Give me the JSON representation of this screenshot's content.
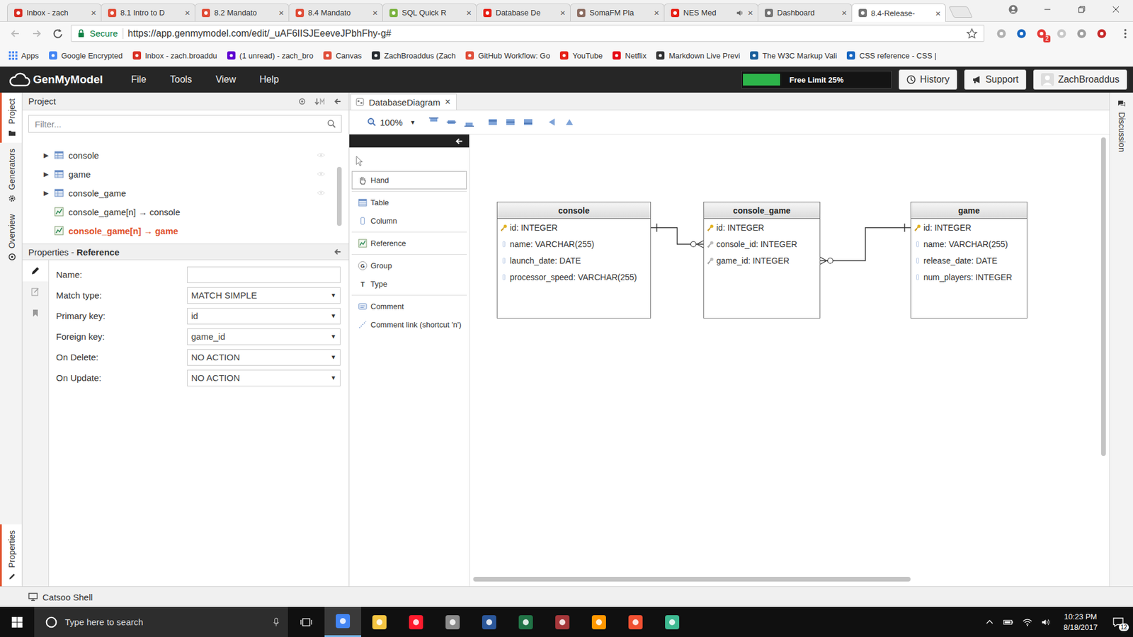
{
  "browser": {
    "tabs": [
      {
        "label": "Inbox - zach",
        "selected": false,
        "audible": false,
        "color": "#d93025"
      },
      {
        "label": "8.1 Intro to D",
        "selected": false,
        "audible": false,
        "color": "#e04e39"
      },
      {
        "label": "8.2 Mandato",
        "selected": false,
        "audible": false,
        "color": "#e04e39"
      },
      {
        "label": "8.4 Mandato",
        "selected": false,
        "audible": false,
        "color": "#e04e39"
      },
      {
        "label": "SQL Quick R",
        "selected": false,
        "audible": false,
        "color": "#7cb342"
      },
      {
        "label": "Database De",
        "selected": false,
        "audible": false,
        "color": "#e62117"
      },
      {
        "label": "SomaFM Pla",
        "selected": false,
        "audible": false,
        "color": "#8d6e63"
      },
      {
        "label": "NES Med",
        "selected": false,
        "audible": true,
        "color": "#e62117"
      },
      {
        "label": "Dashboard",
        "selected": false,
        "audible": false,
        "color": "#757575"
      },
      {
        "label": "8.4-Release-",
        "selected": true,
        "audible": false,
        "color": "#757575"
      }
    ],
    "tab_close": "×",
    "secure_label": "Secure",
    "url": "https://app.genmymodel.com/edit/_uAF6IISJEeeveJPbhFhy-g#",
    "extensions": [
      {
        "badge": "",
        "color": "#b0b0b0"
      },
      {
        "badge": "",
        "color": "#1565c0"
      },
      {
        "badge": "2",
        "color": "#e53935"
      },
      {
        "badge": "",
        "color": "#c8c8c8"
      },
      {
        "badge": "",
        "color": "#9e9e9e"
      },
      {
        "badge": "",
        "color": "#c62828"
      }
    ],
    "bookmarks": [
      {
        "label": "Apps",
        "kind": "apps",
        "color": "#4285f4"
      },
      {
        "label": "Google Encrypted",
        "kind": "site",
        "color": "#4285f4"
      },
      {
        "label": "Inbox - zach.broaddu",
        "kind": "site",
        "color": "#d93025"
      },
      {
        "label": "(1 unread) - zach_bro",
        "kind": "site",
        "color": "#5f01d1"
      },
      {
        "label": "Canvas",
        "kind": "site",
        "color": "#e04e39"
      },
      {
        "label": "ZachBroaddus (Zach",
        "kind": "site",
        "color": "#24292e"
      },
      {
        "label": "GitHub Workflow: Go",
        "kind": "site",
        "color": "#e04e39"
      },
      {
        "label": "YouTube",
        "kind": "site",
        "color": "#e62117"
      },
      {
        "label": "Netflix",
        "kind": "site",
        "color": "#e50914"
      },
      {
        "label": "Markdown Live Previ",
        "kind": "site",
        "color": "#333333"
      },
      {
        "label": "The W3C Markup Vali",
        "kind": "site",
        "color": "#1a5e9a"
      },
      {
        "label": "CSS reference - CSS |",
        "kind": "site",
        "color": "#1565c0"
      }
    ]
  },
  "app": {
    "logo": "GenMyModel",
    "menus": [
      "File",
      "Tools",
      "View",
      "Help"
    ],
    "limit": {
      "label": "Free Limit 25%",
      "level": 0.25
    },
    "buttons": [
      {
        "label": "History",
        "kind": "history"
      },
      {
        "label": "Support",
        "kind": "support"
      }
    ],
    "user": "ZachBroaddus"
  },
  "side_tabs": [
    {
      "label": "Project",
      "kind": "project",
      "selected": true
    },
    {
      "label": "Generators",
      "kind": "generators",
      "selected": false
    },
    {
      "label": "Overview",
      "kind": "overview",
      "selected": false
    }
  ],
  "side_tabs_bottom": [
    {
      "label": "Properties",
      "kind": "properties",
      "selected": true
    }
  ],
  "project": {
    "title": "Project",
    "filter_placeholder": "Filter...",
    "tree": [
      {
        "label": "console",
        "kind": "table",
        "arrow": "▶",
        "selected": false
      },
      {
        "label": "game",
        "kind": "table",
        "arrow": "▶",
        "selected": false
      },
      {
        "label": "console_game",
        "kind": "table",
        "arrow": "▶",
        "selected": false
      },
      {
        "label": "console_game[n] → console",
        "kind": "reference",
        "arrow": "",
        "selected": false
      },
      {
        "label": "console_game[n] → game",
        "kind": "reference",
        "arrow": "",
        "selected": true
      }
    ]
  },
  "properties": {
    "title": "Properties",
    "separator": "-",
    "subject": "Reference",
    "dropdown_arrow": "▼",
    "fields": [
      {
        "label": "Name:",
        "value": "",
        "kind": "text"
      },
      {
        "label": "Match type:",
        "value": "MATCH SIMPLE",
        "kind": "select"
      },
      {
        "label": "Primary key:",
        "value": "id",
        "kind": "select"
      },
      {
        "label": "Foreign key:",
        "value": "game_id",
        "kind": "select"
      },
      {
        "label": "On Delete:",
        "value": "NO ACTION",
        "kind": "select"
      },
      {
        "label": "On Update:",
        "value": "NO ACTION",
        "kind": "select"
      }
    ]
  },
  "editor": {
    "tab": "DatabaseDiagram",
    "tab_close": "×",
    "zoom": "100%",
    "zoom_arrow": "▼",
    "palette": [
      {
        "label": "Hand",
        "kind": "hand",
        "group": 1,
        "selected": true
      },
      {
        "label": "Table",
        "kind": "table",
        "group": 2,
        "selected": false
      },
      {
        "label": "Column",
        "kind": "column",
        "group": 2,
        "selected": false
      },
      {
        "label": "Reference",
        "kind": "reference",
        "group": 3,
        "selected": false
      },
      {
        "label": "Group",
        "kind": "group",
        "glyph": "G",
        "group": 4,
        "selected": false
      },
      {
        "label": "Type",
        "kind": "type",
        "glyph": "T",
        "group": 4,
        "selected": false
      },
      {
        "label": "Comment",
        "kind": "comment",
        "group": 5,
        "selected": false
      },
      {
        "label": "Comment link (shortcut 'n')",
        "kind": "comment-link",
        "group": 5,
        "selected": false
      }
    ],
    "tables": [
      {
        "name": "console",
        "columns": [
          {
            "text": "id: INTEGER",
            "kind": "pk"
          },
          {
            "text": "name: VARCHAR(255)",
            "kind": "col"
          },
          {
            "text": "launch_date: DATE",
            "kind": "col"
          },
          {
            "text": "processor_speed: VARCHAR(255)",
            "kind": "col"
          }
        ]
      },
      {
        "name": "console_game",
        "columns": [
          {
            "text": "id: INTEGER",
            "kind": "pk"
          },
          {
            "text": "console_id: INTEGER",
            "kind": "fk"
          },
          {
            "text": "game_id: INTEGER",
            "kind": "fk"
          }
        ]
      },
      {
        "name": "game",
        "columns": [
          {
            "text": "id: INTEGER",
            "kind": "pk"
          },
          {
            "text": "name: VARCHAR(255)",
            "kind": "col"
          },
          {
            "text": "release_date: DATE",
            "kind": "col"
          },
          {
            "text": "num_players: INTEGER",
            "kind": "col"
          }
        ]
      }
    ],
    "references": [
      {
        "from": "console_game",
        "column": "console_id: INTEGER",
        "to": "console"
      },
      {
        "from": "console_game",
        "column": "game_id: INTEGER",
        "to": "game"
      }
    ]
  },
  "right_tabs": [
    {
      "label": "Discussion",
      "selected": false
    }
  ],
  "shell": {
    "label": "Catsoo Shell"
  },
  "taskbar": {
    "search_placeholder": "Type here to search",
    "apps": [
      {
        "color": "#4285f4",
        "selected": true
      },
      {
        "color": "#f4c542",
        "selected": false
      },
      {
        "color": "#ff1b2d",
        "selected": false
      },
      {
        "color": "#8a8a8a",
        "selected": false
      },
      {
        "color": "#2b579a",
        "selected": false
      },
      {
        "color": "#217346",
        "selected": false
      },
      {
        "color": "#a4373a",
        "selected": false
      },
      {
        "color": "#ff9800",
        "selected": false
      },
      {
        "color": "#f05032",
        "selected": false
      },
      {
        "color": "#3eb991",
        "selected": false
      }
    ],
    "time": "10:23 PM",
    "date": "8/18/2017",
    "notifications": "12"
  }
}
